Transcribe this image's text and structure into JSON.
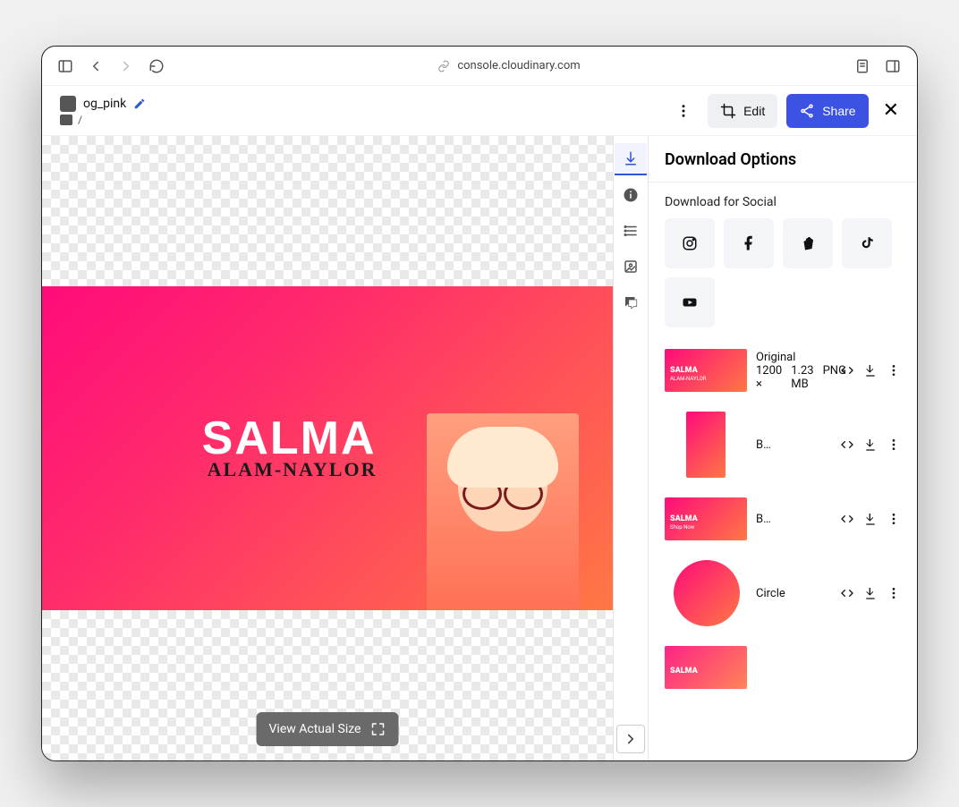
{
  "browser": {
    "url": "console.cloudinary.com"
  },
  "header": {
    "file_name": "og_pink",
    "breadcrumb": "/",
    "edit_label": "Edit",
    "share_label": "Share"
  },
  "canvas": {
    "title_line1": "SALMA",
    "title_line2": "ALAM-NAYLOR",
    "view_actual_label": "View Actual Size"
  },
  "panel": {
    "title": "Download Options",
    "social_label": "Download for Social",
    "social": [
      "instagram",
      "facebook",
      "shopify",
      "tiktok",
      "youtube"
    ],
    "downloads": [
      {
        "name": "Original",
        "dims": "1200 ×",
        "size": "1.23 MB",
        "format": "PNG",
        "shape": "wide"
      },
      {
        "name": "B…",
        "shape": "portrait"
      },
      {
        "name": "B…",
        "shape": "wide-shop",
        "overlay": "Shop Now"
      },
      {
        "name": "Circle",
        "shape": "circle"
      },
      {
        "name": "",
        "shape": "wide"
      }
    ]
  }
}
